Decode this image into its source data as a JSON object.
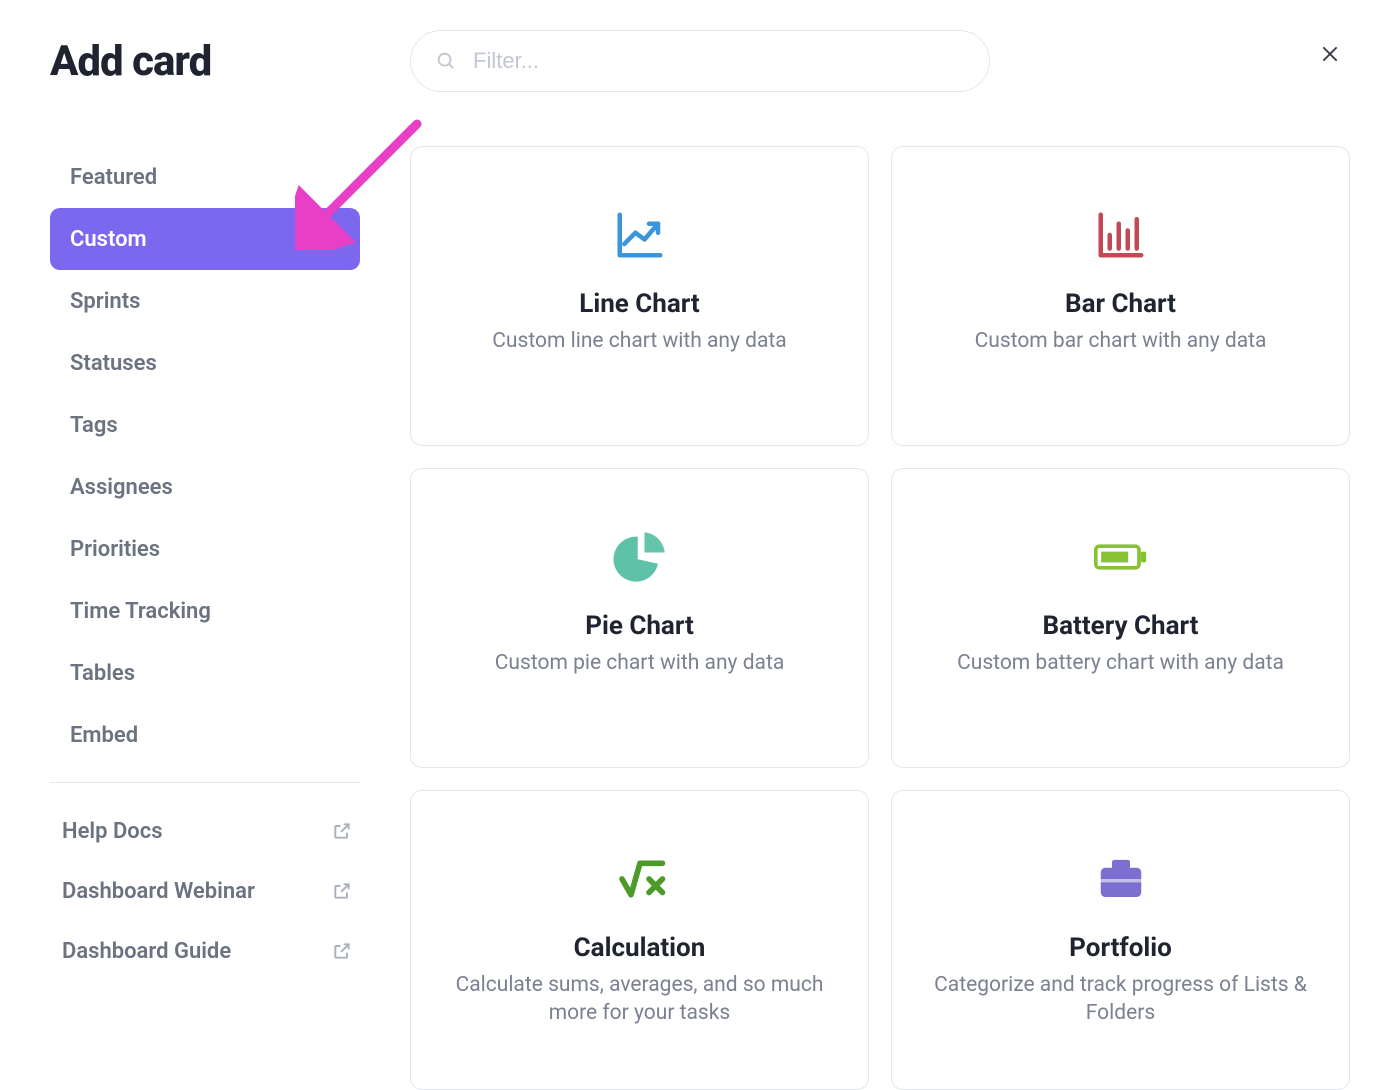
{
  "header": {
    "title": "Add card",
    "search_placeholder": "Filter..."
  },
  "sidebar": {
    "items": [
      {
        "label": "Featured",
        "active": false
      },
      {
        "label": "Custom",
        "active": true
      },
      {
        "label": "Sprints",
        "active": false
      },
      {
        "label": "Statuses",
        "active": false
      },
      {
        "label": "Tags",
        "active": false
      },
      {
        "label": "Assignees",
        "active": false
      },
      {
        "label": "Priorities",
        "active": false
      },
      {
        "label": "Time Tracking",
        "active": false
      },
      {
        "label": "Tables",
        "active": false
      },
      {
        "label": "Embed",
        "active": false
      }
    ],
    "links": [
      {
        "label": "Help Docs"
      },
      {
        "label": "Dashboard Webinar"
      },
      {
        "label": "Dashboard Guide"
      }
    ]
  },
  "cards": [
    {
      "icon": "line-chart-icon",
      "color": "#3a95dc",
      "title": "Line Chart",
      "desc": "Custom line chart with any data"
    },
    {
      "icon": "bar-chart-icon",
      "color": "#c24a57",
      "title": "Bar Chart",
      "desc": "Custom bar chart with any data"
    },
    {
      "icon": "pie-chart-icon",
      "color": "#5dc2a7",
      "title": "Pie Chart",
      "desc": "Custom pie chart with any data"
    },
    {
      "icon": "battery-chart-icon",
      "color": "#86c232",
      "title": "Battery Chart",
      "desc": "Custom battery chart with any data"
    },
    {
      "icon": "calculation-icon",
      "color": "#4c9a2a",
      "title": "Calculation",
      "desc": "Calculate sums, averages, and so much more for your tasks"
    },
    {
      "icon": "portfolio-icon",
      "color": "#7b6fd0",
      "title": "Portfolio",
      "desc": "Categorize and track progress of Lists & Folders"
    }
  ],
  "annotation": {
    "arrow_color": "#e83fc7"
  }
}
